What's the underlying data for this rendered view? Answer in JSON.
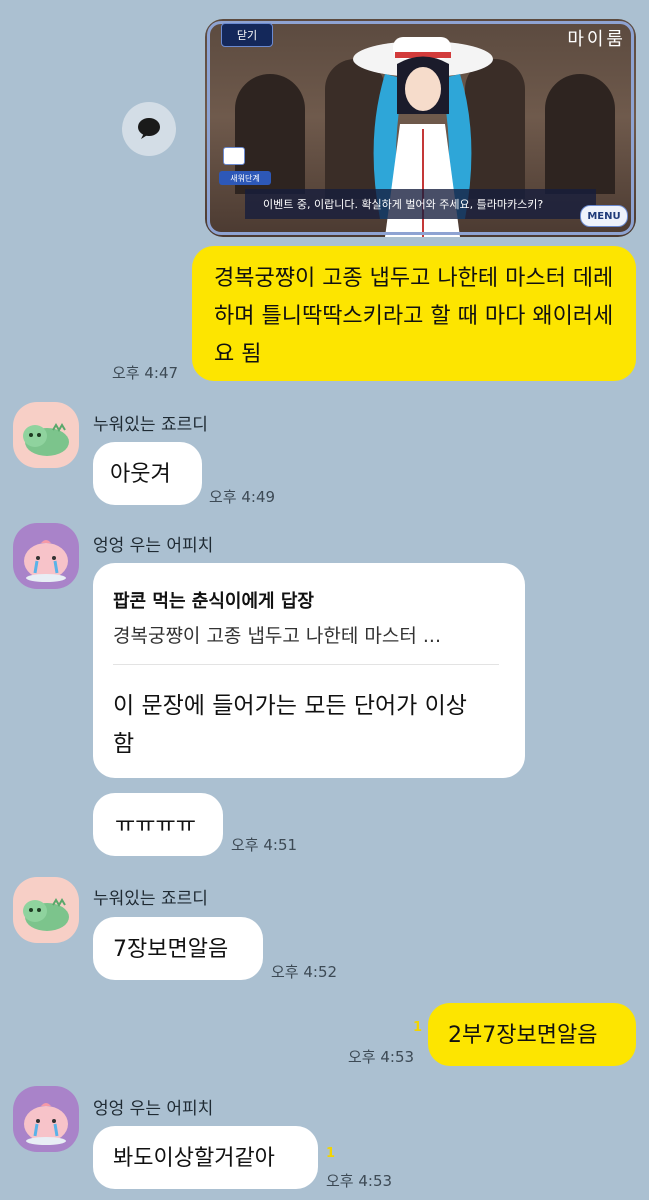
{
  "shared_image": {
    "close_label": "닫기",
    "logo": "마이룸",
    "side_tag_1": "새워단계",
    "dialogue": "이벤트 중, 이랍니다. 확실하게 벌어와 주세요, 틀라마카스키?",
    "menu_label": "MENU"
  },
  "messages": {
    "m1": {
      "text": "경복궁쨩이 고종 냅두고 나한테 마스터 데레하며 틀니딱딱스키라고 할 때 마다 왜이러세요 됨",
      "time": "오후 4:47"
    },
    "m2": {
      "sender": "누워있는 죠르디",
      "text": "아웃겨",
      "time": "오후 4:49"
    },
    "m3": {
      "sender": "엉엉 우는 어피치",
      "reply_title": "팝콘 먹는 춘식이에게 답장",
      "reply_quote": "경복궁쨩이 고종 냅두고 나한테 마스터 ...",
      "text": "이 문장에 들어가는 모든 단어가 이상함"
    },
    "m4": {
      "text": "ㅠㅠㅠㅠ",
      "time": "오후 4:51"
    },
    "m5": {
      "sender": "누워있는 죠르디",
      "text": "7장보면알음",
      "time": "오후 4:52"
    },
    "m6": {
      "text": "2부7장보면알음",
      "time": "오후 4:53",
      "unread": "1"
    },
    "m7": {
      "sender": "엉엉 우는 어피치",
      "text": "봐도이상할거같아",
      "time": "오후 4:53",
      "unread": "1"
    }
  },
  "colors": {
    "background": "#abc0d1",
    "my_bubble": "#fde500",
    "their_bubble": "#ffffff",
    "unread_badge": "#f2d400"
  },
  "icons": {
    "share": "speech-bubble-icon",
    "avatar_jordy": "jordy-character-icon",
    "avatar_apeach": "apeach-character-icon"
  }
}
